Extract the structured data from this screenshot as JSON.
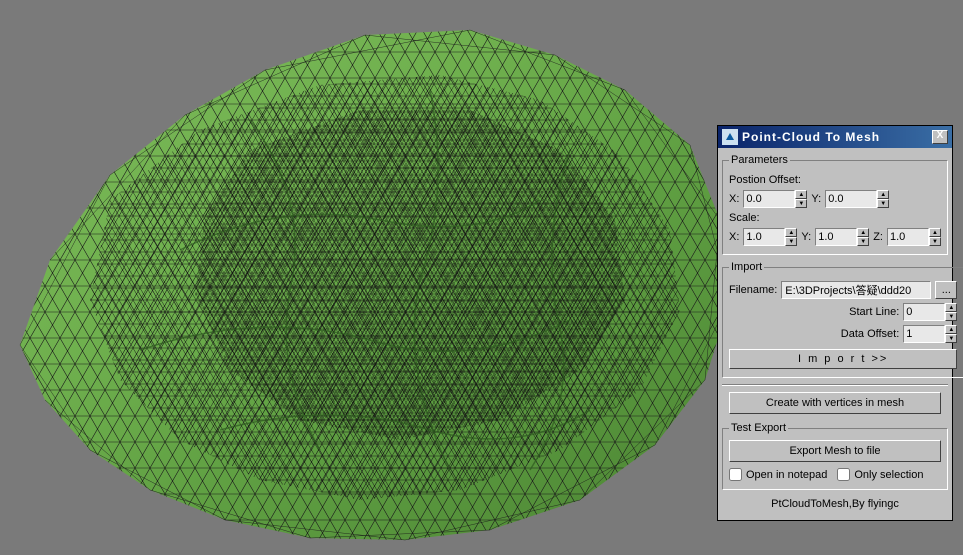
{
  "panel": {
    "title": "Point-Cloud To Mesh",
    "close": "X"
  },
  "parameters": {
    "legend": "Parameters",
    "position_offset_label": "Postion Offset:",
    "x_label": "X:",
    "y_label": "Y:",
    "z_label": "Z:",
    "offset_x": "0.0",
    "offset_y": "0.0",
    "scale_label": "Scale:",
    "scale_x": "1.0",
    "scale_y": "1.0",
    "scale_z": "1.0"
  },
  "import": {
    "legend": "Import",
    "filename_label": "Filename:",
    "filename": "E:\\3DProjects\\答疑\\ddd20",
    "browse": "...",
    "start_line_label": "Start Line:",
    "start_line": "0",
    "data_offset_label": "Data Offset:",
    "data_offset": "1",
    "import_btn": "I m p o r t >>"
  },
  "create_btn": "Create with vertices in mesh",
  "test_export": {
    "legend": "Test Export",
    "export_btn": "Export Mesh to file",
    "open_notepad": "Open in notepad",
    "only_selection": "Only selection"
  },
  "credit": "PtCloudToMesh,By flyingc"
}
